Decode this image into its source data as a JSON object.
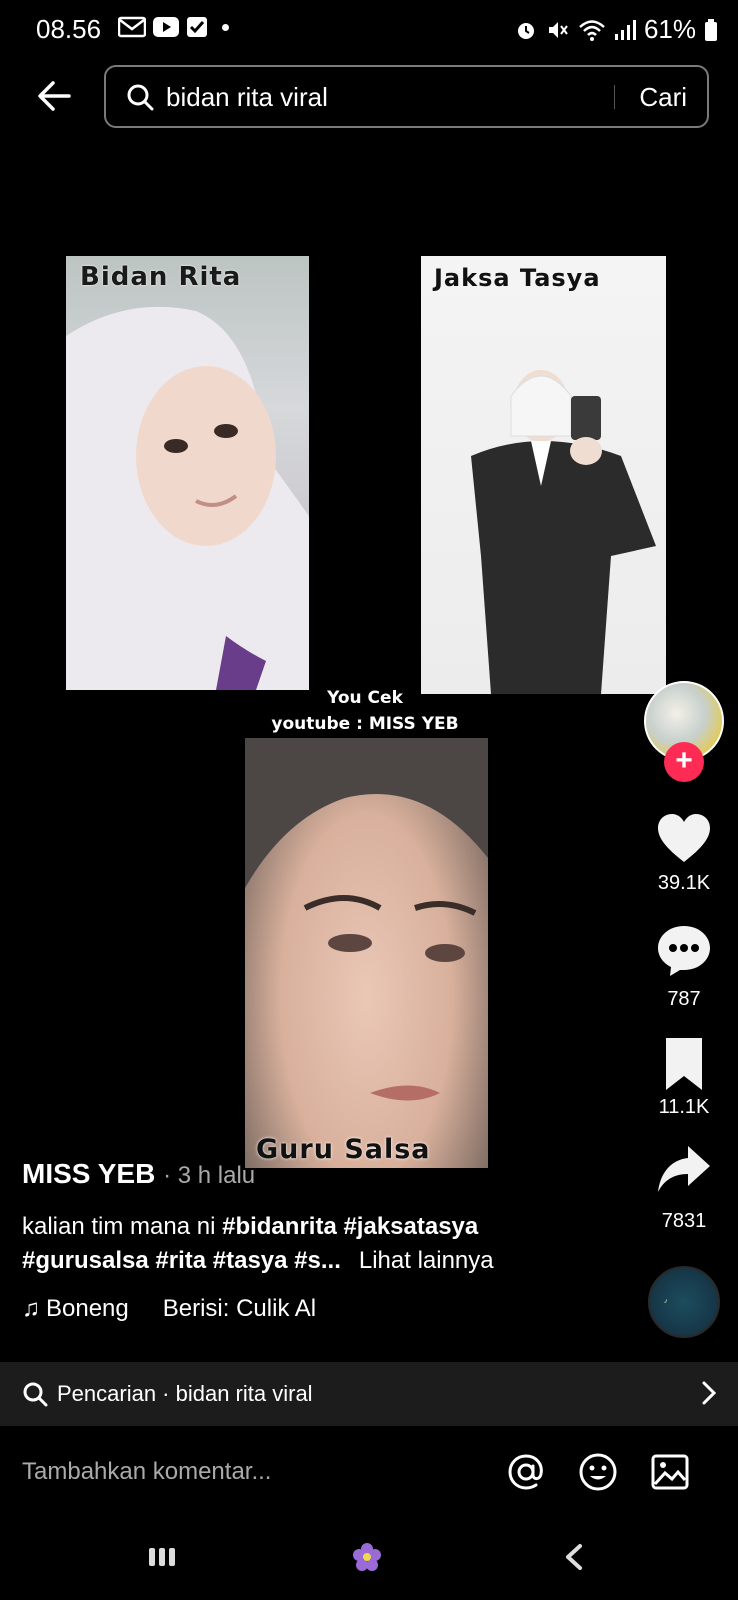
{
  "status_bar": {
    "time": "08.56",
    "battery": "61%",
    "icons": [
      "gmail-icon",
      "youtube-icon",
      "checkbox-icon",
      "dot-icon",
      "alarm-icon",
      "mute-icon",
      "wifi-icon",
      "signal-icon",
      "battery-icon"
    ]
  },
  "header": {
    "query": "bidan rita viral",
    "search_button": "Cari"
  },
  "video": {
    "labels": {
      "rita": "Bidan Rita",
      "tasya": "Jaksa Tasya",
      "salsa": "Guru Salsa"
    },
    "overlay_line1": "You Cek",
    "overlay_line2": "youtube : MISS YEB"
  },
  "rail": {
    "likes": "39.1K",
    "comments": "787",
    "bookmarks": "11.1K",
    "shares": "7831",
    "follow_symbol": "+"
  },
  "post": {
    "author": "MISS YEB",
    "time": "· 3 h lalu",
    "caption_plain": "kalian tim mana ni ",
    "caption_tags1": "#bidanrita #jaksatasya",
    "caption_tags2": "#gurusalsa #rita #tasya #s...",
    "see_more": "Lihat lainnya",
    "sound_name": "Boneng",
    "sound_contains": "Berisi: Culik Al"
  },
  "search_strip": {
    "text": "Pencarian · bidan rita viral"
  },
  "comment_bar": {
    "placeholder": "Tambahkan komentar..."
  },
  "colors": {
    "background": "#000000",
    "follow_badge": "#fe2c55",
    "strip": "#1c1c1c"
  }
}
